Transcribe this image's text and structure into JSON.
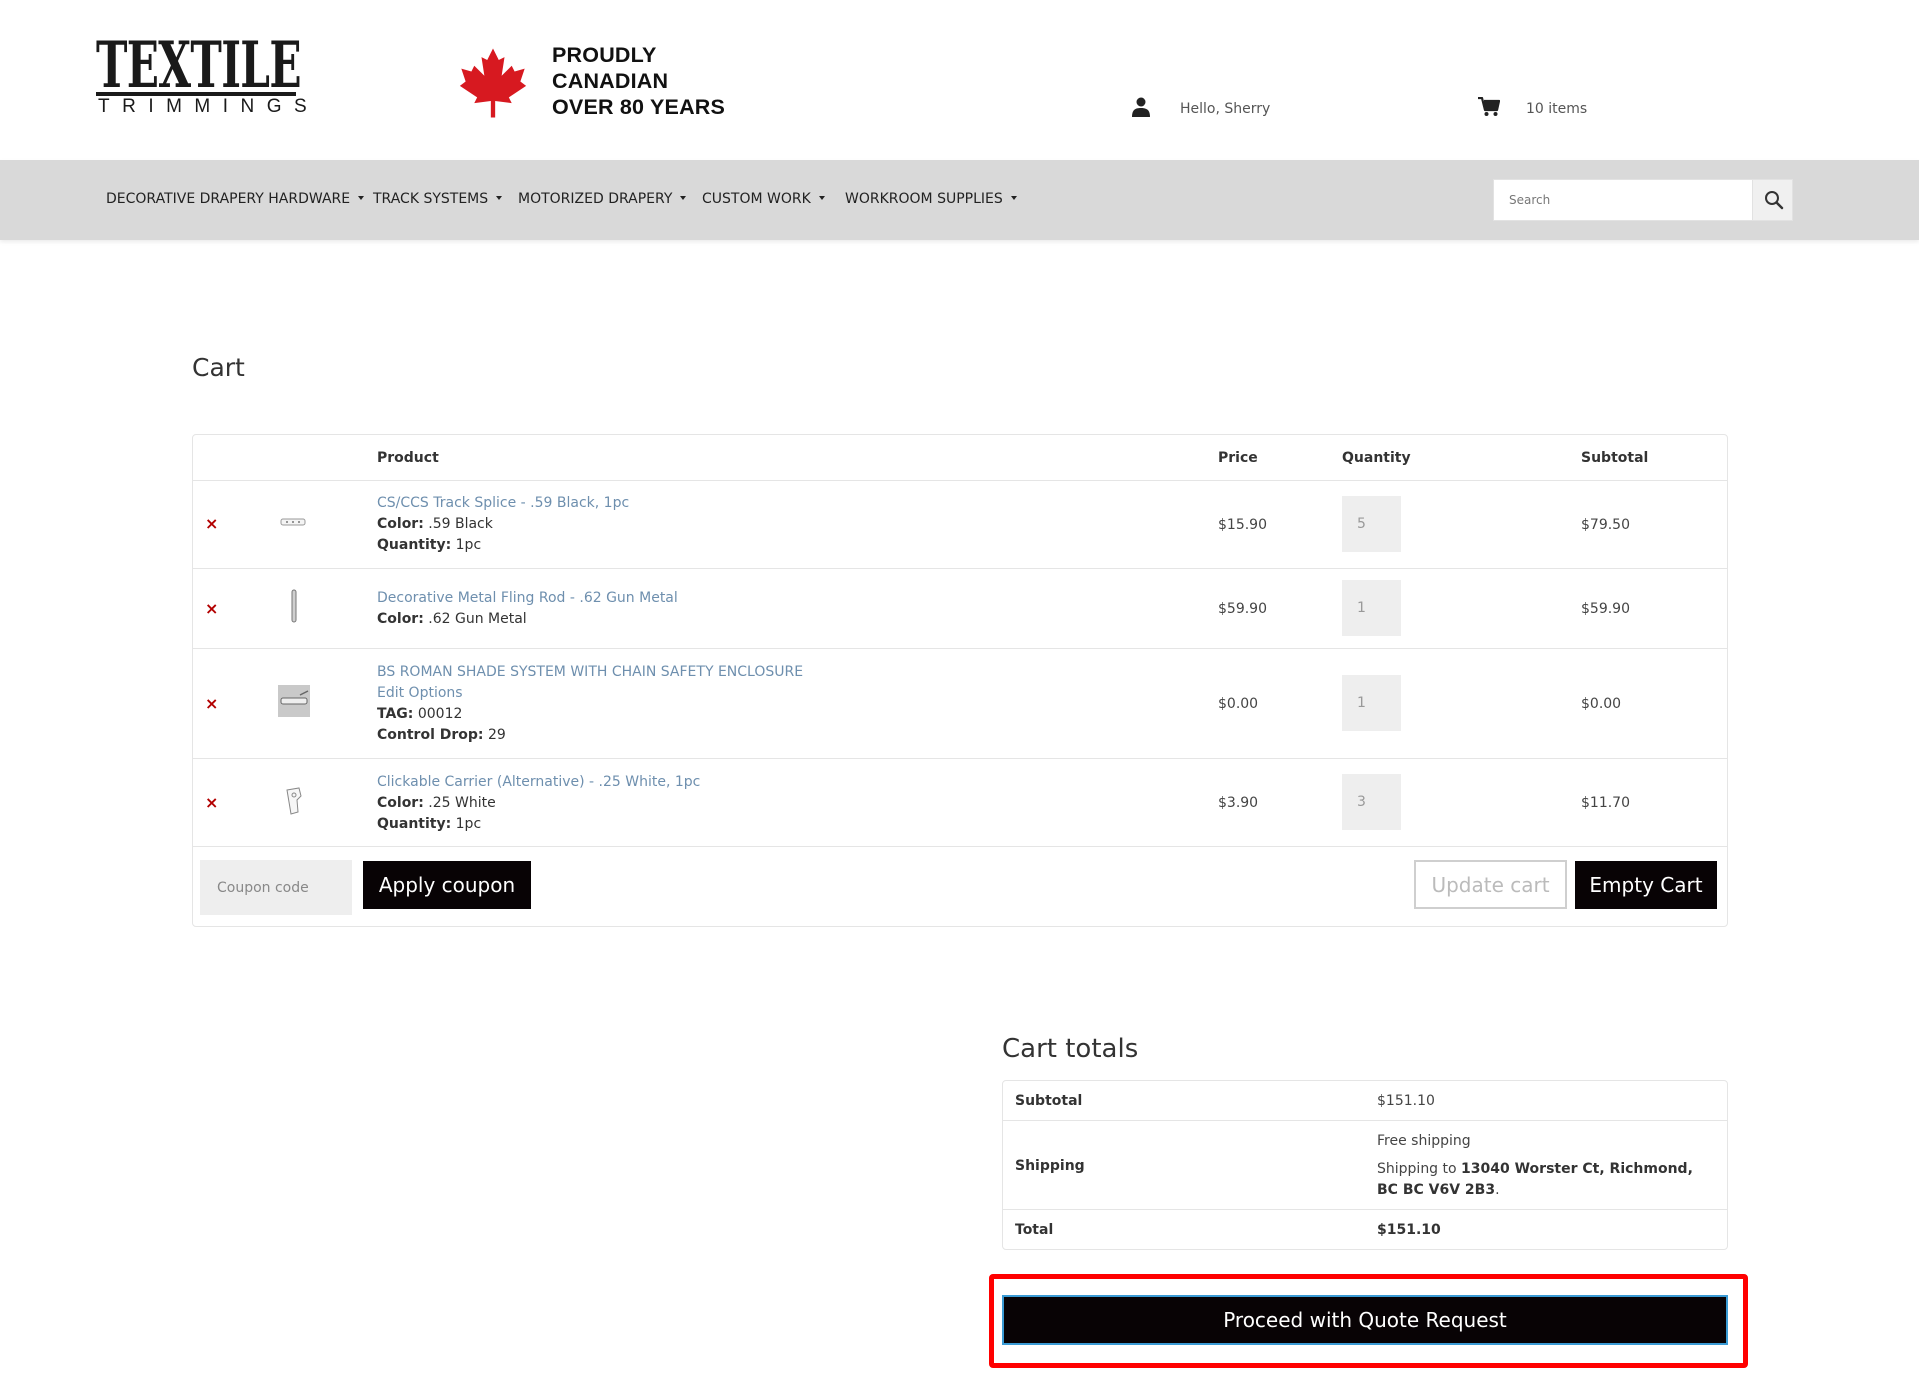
{
  "header": {
    "logo_main": "TEXTILE",
    "logo_sub": "TRIMMINGS",
    "tagline": [
      "PROUDLY",
      "CANADIAN",
      "OVER 80 YEARS"
    ],
    "greeting": "Hello, Sherry",
    "cart_count": "10 items"
  },
  "nav": {
    "items": [
      {
        "label": "DECORATIVE DRAPERY HARDWARE"
      },
      {
        "label": "TRACK SYSTEMS"
      },
      {
        "label": "MOTORIZED DRAPERY"
      },
      {
        "label": "CUSTOM WORK"
      },
      {
        "label": "WORKROOM SUPPLIES"
      }
    ],
    "search_placeholder": "Search"
  },
  "cart": {
    "title": "Cart",
    "columns": {
      "product": "Product",
      "price": "Price",
      "quantity": "Quantity",
      "subtotal": "Subtotal"
    },
    "remove_symbol": "×",
    "items": [
      {
        "name": "CS/CCS Track Splice - .59 Black, 1pc",
        "meta": [
          {
            "label": "Color:",
            "value": " .59 Black"
          },
          {
            "label": "Quantity:",
            "value": " 1pc"
          }
        ],
        "price": "$15.90",
        "qty": "5",
        "subtotal": "$79.50"
      },
      {
        "name": "Decorative Metal Fling Rod - .62 Gun Metal",
        "meta": [
          {
            "label": "Color:",
            "value": " .62 Gun Metal"
          }
        ],
        "price": "$59.90",
        "qty": "1",
        "subtotal": "$59.90"
      },
      {
        "name": "BS ROMAN SHADE SYSTEM WITH CHAIN SAFETY ENCLOSURE",
        "edit_link": "Edit Options",
        "meta": [
          {
            "label": "TAG:",
            "value": " 00012"
          },
          {
            "label": "Control Drop:",
            "value": " 29"
          }
        ],
        "price": "$0.00",
        "qty": "1",
        "subtotal": "$0.00"
      },
      {
        "name": "Clickable Carrier (Alternative) - .25 White, 1pc",
        "meta": [
          {
            "label": "Color:",
            "value": " .25 White"
          },
          {
            "label": "Quantity:",
            "value": " 1pc"
          }
        ],
        "price": "$3.90",
        "qty": "3",
        "subtotal": "$11.70"
      }
    ],
    "coupon_placeholder": "Coupon code",
    "apply_coupon": "Apply coupon",
    "update_cart": "Update cart",
    "empty_cart": "Empty Cart"
  },
  "totals": {
    "title": "Cart totals",
    "subtotal_label": "Subtotal",
    "subtotal_value": "$151.10",
    "shipping_label": "Shipping",
    "shipping_method": "Free shipping",
    "shipping_prefix": "Shipping to ",
    "shipping_address": "13040 Worster Ct, Richmond, BC BC V6V 2B3",
    "shipping_suffix": ".",
    "total_label": "Total",
    "total_value": "$151.10",
    "proceed": "Proceed with Quote Request"
  },
  "colors": {
    "nav_bg": "#d9d9d9",
    "link": "#6e8fae",
    "remove": "#b30000",
    "button": "#080305",
    "highlight": "#ff0000",
    "maple_leaf": "#d71920"
  }
}
